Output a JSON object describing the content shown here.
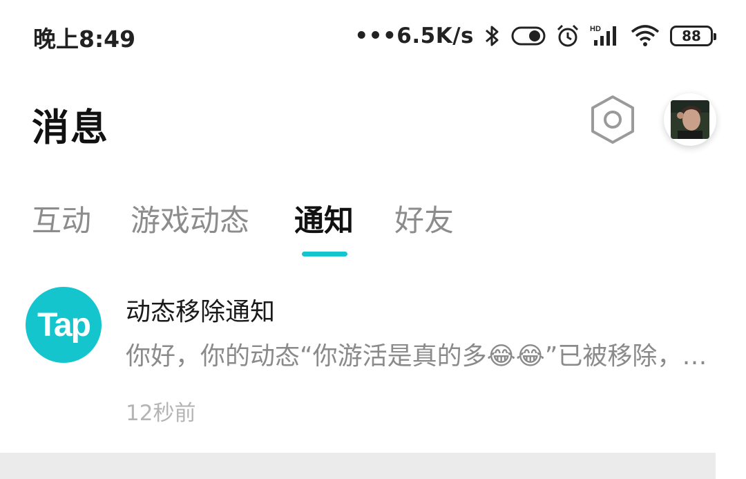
{
  "status_bar": {
    "time": "晚上8:49",
    "net_speed": "•••6.5K/s",
    "battery": "88",
    "icons": [
      "bluetooth-icon",
      "toggle-icon",
      "alarm-icon",
      "hd-signal-icon",
      "wifi-icon",
      "battery-icon"
    ]
  },
  "header": {
    "title": "消息",
    "settings_icon": "settings-icon"
  },
  "tabs": [
    {
      "label": "互动",
      "active": false
    },
    {
      "label": "游戏动态",
      "active": false
    },
    {
      "label": "通知",
      "active": true
    },
    {
      "label": "好友",
      "active": false
    }
  ],
  "notifications": [
    {
      "avatar_text": "Tap",
      "title": "动态移除通知",
      "body": "你好，你的动态“你游活是真的多😂😂”已被移除，如有疑问请联系客服",
      "time": "12秒前"
    }
  ],
  "colors": {
    "accent": "#15c5ce",
    "text_primary": "#111111",
    "text_secondary": "#8a8a8a",
    "text_tertiary": "#b4b4b4"
  }
}
